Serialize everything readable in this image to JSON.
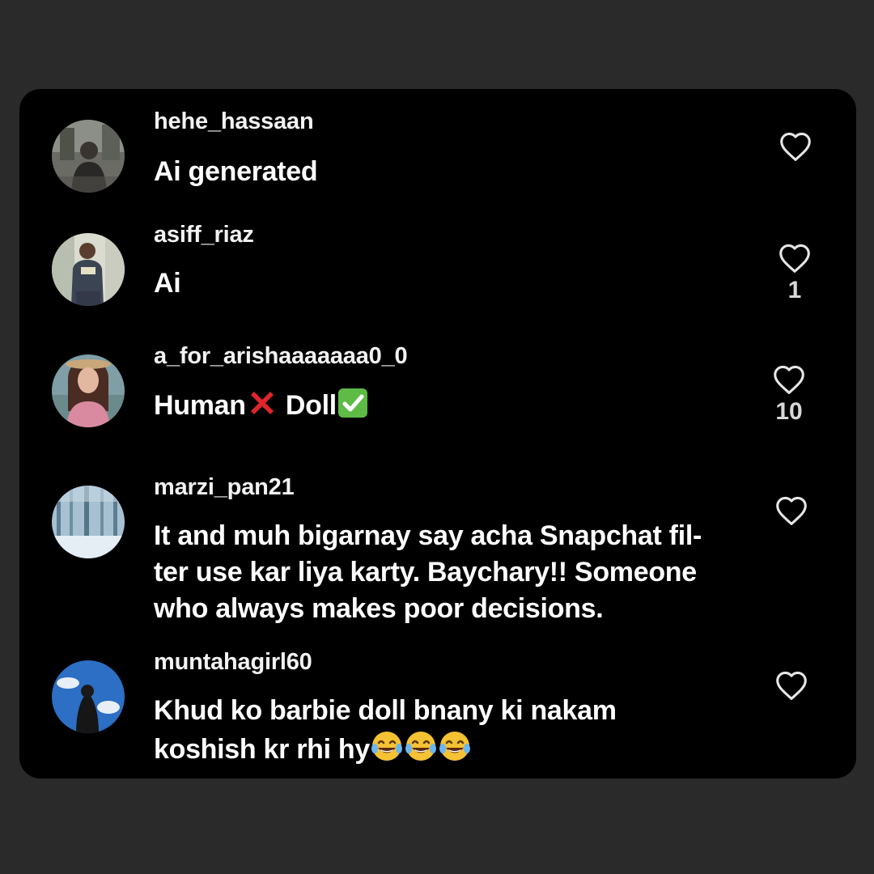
{
  "comments": [
    {
      "username": "hehe_hassaan",
      "lines": [
        "Ai generated"
      ],
      "likes": "",
      "avatar_icon": "person-photo-avatar"
    },
    {
      "username": "asiff_riaz",
      "lines": [
        "Ai"
      ],
      "likes": "1",
      "avatar_icon": "person-photo-avatar"
    },
    {
      "username": "a_for_arishaaaaaaa0_0",
      "lines": [
        "Human",
        "Doll"
      ],
      "emojis": [
        "cross-mark-emoji",
        "check-mark-button-emoji"
      ],
      "likes": "10",
      "avatar_icon": "person-photo-avatar"
    },
    {
      "username": "marzi_pan21",
      "lines": [
        "It and muh bigarnay say acha Snapchat fil-",
        "ter use kar liya karty. Baychary!! Someone",
        "who always makes poor decisions."
      ],
      "likes": "",
      "avatar_icon": "snowy-forest-avatar"
    },
    {
      "username": "muntahagirl60",
      "lines": [
        "Khud ko barbie doll bnany ki nakam",
        "koshish kr rhi hy"
      ],
      "emojis": [
        "tears-of-joy-emoji",
        "tears-of-joy-emoji",
        "tears-of-joy-emoji"
      ],
      "likes": "",
      "avatar_icon": "sky-silhouette-avatar"
    }
  ],
  "colors": {
    "background": "#2a2a2a",
    "card": "#000000",
    "text": "#ffffff",
    "heart_stroke": "#e6e6e6",
    "cross_red": "#e0242b",
    "check_green": "#5dbb46"
  }
}
